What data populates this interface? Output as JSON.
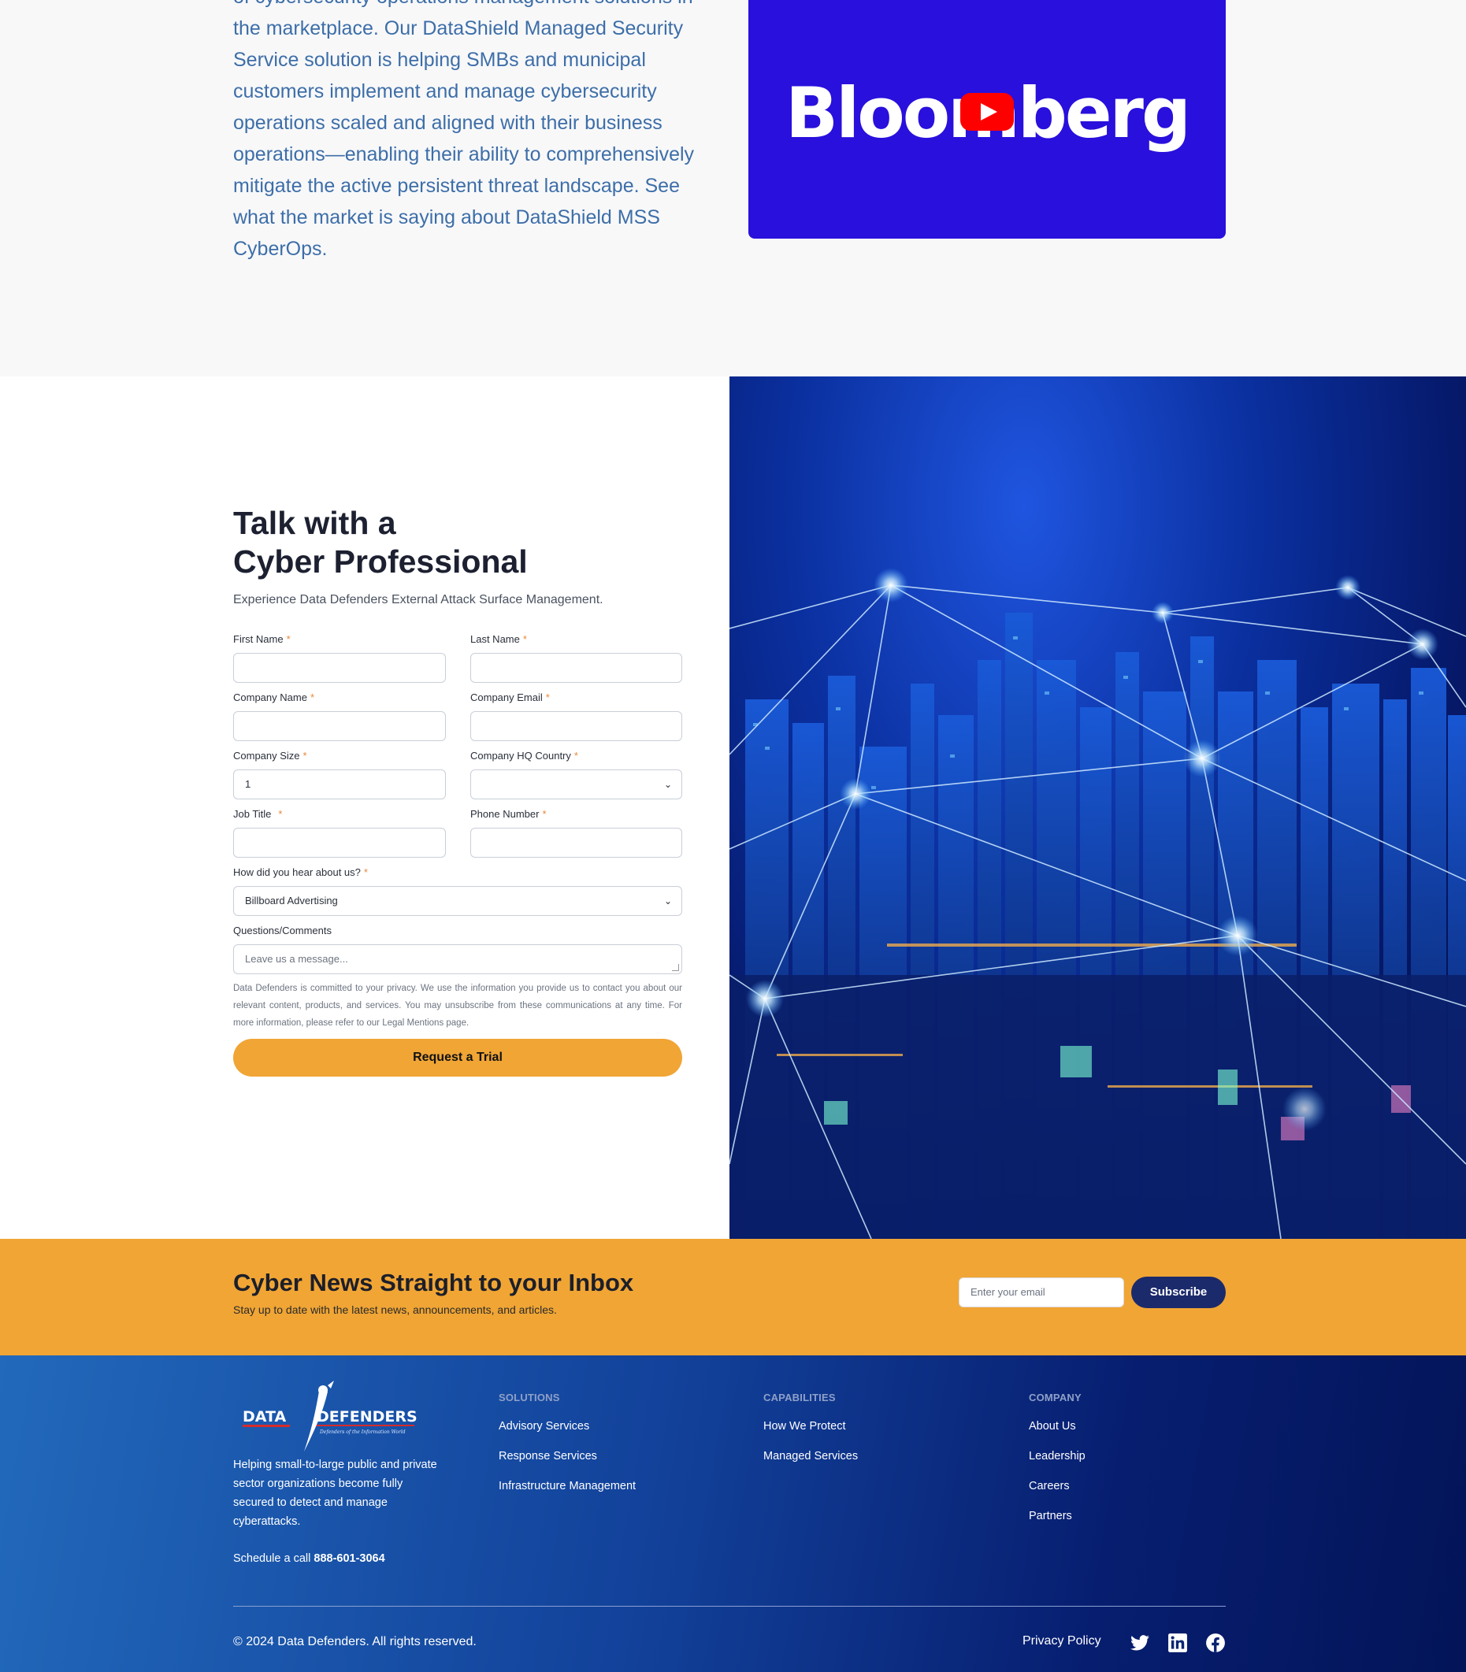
{
  "intro": {
    "text": "of cybersecurity operations management solutions in the marketplace. Our DataShield Managed Security Service solution is helping SMBs and municipal customers implement and manage cybersecurity operations scaled and aligned with their business operations—enabling their ability to comprehensively mitigate the active persistent threat landscape. See what the market is saying about DataShield MSS CyberOps.",
    "video_logo": "Bloomberg",
    "video_bg": "#2910dc"
  },
  "contact": {
    "title_line1": "Talk with a",
    "title_line2": "Cyber Professional",
    "subtitle": "Experience Data Defenders External Attack Surface Management.",
    "fields": {
      "first_name": {
        "label": "First Name",
        "value": ""
      },
      "last_name": {
        "label": "Last Name",
        "value": ""
      },
      "company_name": {
        "label": "Company Name",
        "value": ""
      },
      "company_email": {
        "label": "Company Email",
        "value": ""
      },
      "company_size": {
        "label": "Company Size",
        "value": "1"
      },
      "company_country": {
        "label": "Company HQ Country",
        "value": ""
      },
      "job_title": {
        "label": "Job Title",
        "value": ""
      },
      "phone": {
        "label": "Phone Number",
        "value": ""
      },
      "hear_about": {
        "label": "How did you hear about us?",
        "value": "Billboard Advertising"
      },
      "comments": {
        "label": "Questions/Comments",
        "placeholder": "Leave us a message..."
      }
    },
    "required_mark": "*",
    "privacy": "Data Defenders is committed to your privacy. We use the information you provide us to contact you about our relevant content, products, and services. You may unsubscribe from these communications at any time. For more information, please refer to our Legal Mentions page.",
    "submit": "Request a Trial"
  },
  "newsletter": {
    "title": "Cyber News Straight to your Inbox",
    "subtitle": "Stay up to date with the latest news, announcements, and articles.",
    "email_placeholder": "Enter your email",
    "button": "Subscribe"
  },
  "footer": {
    "logo_left": "DATA",
    "logo_right": "DEFENDERS",
    "logo_tagline": "Defenders of the Information World",
    "description": "Helping small-to-large public and private sector organizations become fully secured to detect and manage cyberattacks.",
    "call_prefix": "Schedule a call",
    "call_number": "888-601-3064",
    "columns": [
      {
        "heading": "SOLUTIONS",
        "links": [
          "Advisory Services",
          "Response Services",
          "Infrastructure Management"
        ]
      },
      {
        "heading": "CAPABILITIES",
        "links": [
          "How We Protect",
          "Managed Services"
        ]
      },
      {
        "heading": "COMPANY",
        "links": [
          "About Us",
          "Leadership",
          "Careers",
          "Partners"
        ]
      }
    ],
    "copyright": "© 2024 Data Defenders. All rights reserved.",
    "privacy_policy": "Privacy Policy",
    "social_icons": [
      "twitter-icon",
      "linkedin-icon",
      "facebook-icon"
    ]
  },
  "colors": {
    "accent_orange": "#f0a535",
    "navy_button": "#1b2a6b",
    "intro_text": "#3d6ea8"
  }
}
